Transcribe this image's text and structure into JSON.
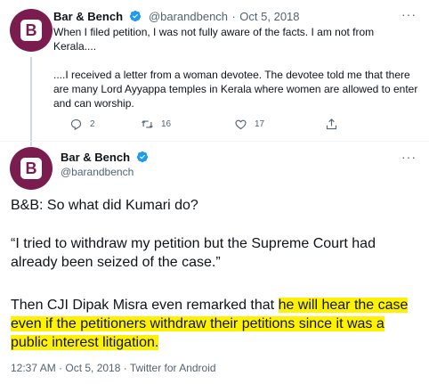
{
  "tweet1": {
    "name": "Bar & Bench",
    "handle": "@barandbench",
    "sep": "·",
    "date": "Oct 5, 2018",
    "more": "···",
    "para1": "When I filed petition, I was not fully aware of the facts. I am not from Kerala....",
    "para2": "....I received a letter from a woman devotee. The devotee told me that there are many Lord Ayyappa temples in Kerala where women are allowed to enter and can worship.",
    "actions": {
      "replies": "2",
      "retweets": "16",
      "likes": "17"
    }
  },
  "tweet2": {
    "name": "Bar & Bench",
    "handle": "@barandbench",
    "more": "···",
    "line1": "B&B: So what did Kumari do?",
    "line2": "“I tried to withdraw my petition but the Supreme Court had already been seized of the case.”",
    "line3_pre": "Then CJI Dipak Misra even remarked that ",
    "line3_hl": "he will hear the case even if the petitioners withdraw their petitions since it was a public interest litigation.",
    "timestamp": "12:37 AM · Oct 5, 2018 · Twitter for Android"
  },
  "avatar_letter": "B",
  "colors": {
    "avatar": "#7b1c4f",
    "verified": "#1d9bf0",
    "highlight": "#fff200",
    "muted": "#536471"
  },
  "icons": [
    "reply-icon",
    "retweet-icon",
    "like-icon",
    "share-icon",
    "verified-icon",
    "more-icon"
  ]
}
